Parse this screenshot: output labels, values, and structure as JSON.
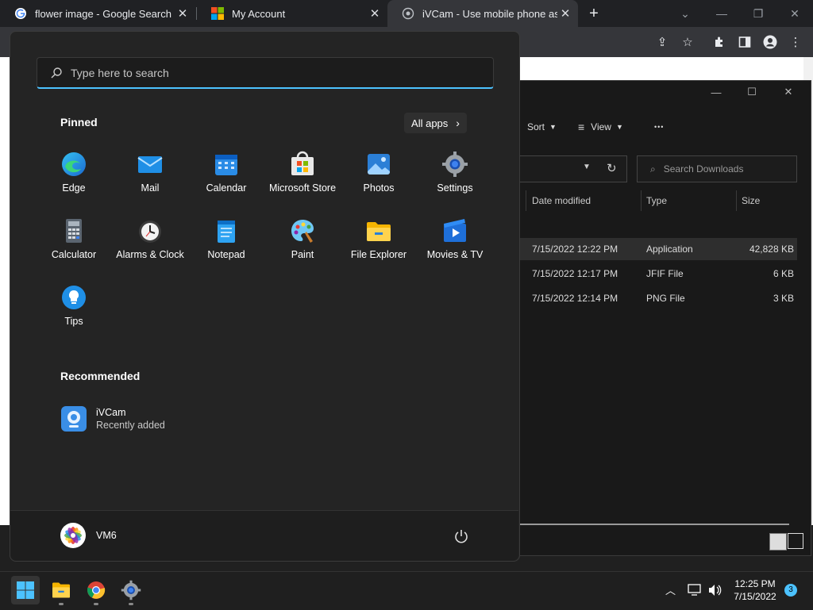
{
  "browser": {
    "tabs": [
      {
        "title": "flower image - Google Search",
        "close": "✕"
      },
      {
        "title": "My Account",
        "close": "✕"
      },
      {
        "title": "iVCam - Use mobile phone as a P",
        "close": "✕"
      }
    ],
    "new_tab": "+",
    "window_controls": {
      "tabsearch": "⌄",
      "minimize": "—",
      "restore": "❐",
      "close": "✕"
    }
  },
  "explorer": {
    "title_controls": {
      "minimize": "—",
      "maximize": "☐",
      "close": "✕"
    },
    "commands": {
      "sort": "Sort",
      "view": "View",
      "more": "•••"
    },
    "search_placeholder": "Search Downloads",
    "columns": [
      "Date modified",
      "Type",
      "Size"
    ],
    "rows": [
      {
        "date": "7/15/2022 12:22 PM",
        "type": "Application",
        "size": "42,828 KB"
      },
      {
        "date": "7/15/2022 12:17 PM",
        "type": "JFIF File",
        "size": "6 KB"
      },
      {
        "date": "7/15/2022 12:14 PM",
        "type": "PNG File",
        "size": "3 KB"
      }
    ]
  },
  "start_menu": {
    "search_placeholder": "Type here to search",
    "pinned_title": "Pinned",
    "all_apps": "All apps",
    "pinned": [
      {
        "label": "Edge",
        "icon": "edge-icon"
      },
      {
        "label": "Mail",
        "icon": "mail-icon"
      },
      {
        "label": "Calendar",
        "icon": "calendar-icon"
      },
      {
        "label": "Microsoft Store",
        "icon": "store-icon"
      },
      {
        "label": "Photos",
        "icon": "photos-icon"
      },
      {
        "label": "Settings",
        "icon": "settings-icon"
      },
      {
        "label": "Calculator",
        "icon": "calculator-icon"
      },
      {
        "label": "Alarms & Clock",
        "icon": "clock-icon"
      },
      {
        "label": "Notepad",
        "icon": "notepad-icon"
      },
      {
        "label": "Paint",
        "icon": "paint-icon"
      },
      {
        "label": "File Explorer",
        "icon": "folder-icon"
      },
      {
        "label": "Movies & TV",
        "icon": "movies-icon"
      },
      {
        "label": "Tips",
        "icon": "tips-icon"
      }
    ],
    "recommended_title": "Recommended",
    "recommended": [
      {
        "name": "iVCam",
        "sub": "Recently added",
        "icon": "ivcam-icon"
      }
    ],
    "user": "VM6"
  },
  "taskbar": {
    "time": "12:25 PM",
    "date": "7/15/2022",
    "notification_count": "3"
  },
  "colors": {
    "accent": "#4cc2ff",
    "start_bg": "#242424",
    "taskbar_bg": "#1f1f1f"
  }
}
